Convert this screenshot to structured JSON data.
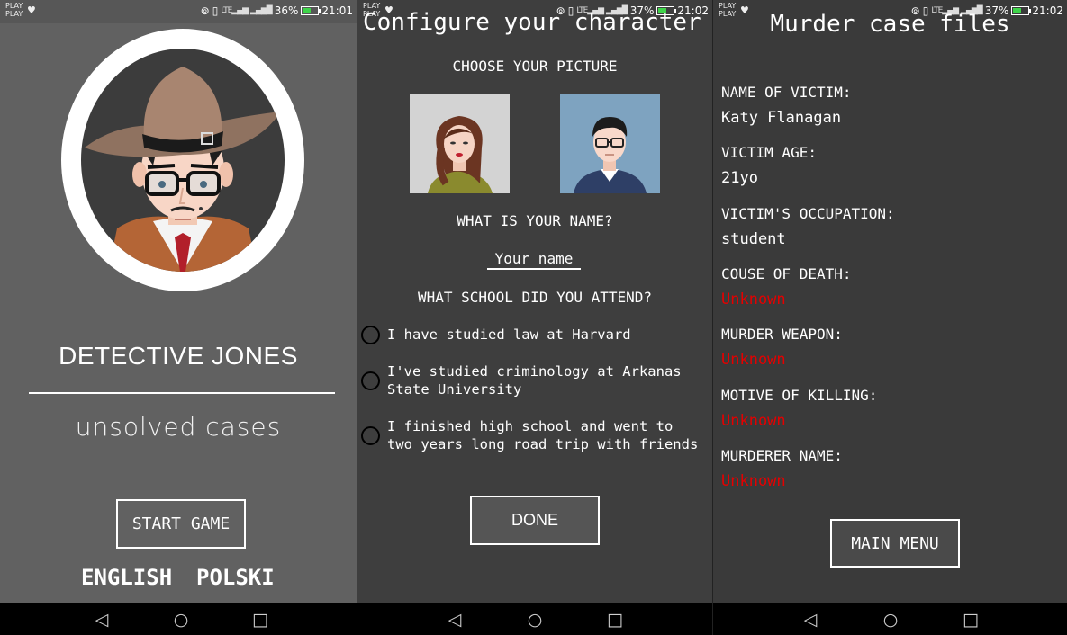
{
  "status_bars": [
    {
      "carrier": [
        "PLAY",
        "PLAY"
      ],
      "battery": "36%",
      "time": "21:01"
    },
    {
      "carrier": [
        "PLAY",
        "PLAY"
      ],
      "battery": "37%",
      "time": "21:02"
    },
    {
      "carrier": [
        "PLAY",
        "PLAY"
      ],
      "battery": "37%",
      "time": "21:02"
    }
  ],
  "home": {
    "title": "DETECTIVE JONES",
    "subtitle": "unsolved cases",
    "start_button": "START GAME",
    "languages": [
      "ENGLISH",
      "POLSKI"
    ]
  },
  "config": {
    "title": "Configure your character",
    "choose_picture_label": "CHOOSE YOUR PICTURE",
    "name_label": "WHAT IS YOUR NAME?",
    "name_placeholder": "Your name",
    "school_label": "WHAT SCHOOL DID YOU ATTEND?",
    "school_options": [
      "I have studied law at Harvard",
      "I've studied criminology at Arkanas State University",
      "I finished high school and went to two years long road trip with friends"
    ],
    "done_button": "DONE"
  },
  "case_files": {
    "title": "Murder case files",
    "fields": [
      {
        "label": "NAME OF VICTIM:",
        "value": "Katy Flanagan",
        "unknown": false
      },
      {
        "label": "VICTIM AGE:",
        "value": "21yo",
        "unknown": false
      },
      {
        "label": "VICTIM'S OCCUPATION:",
        "value": "student",
        "unknown": false
      },
      {
        "label": "COUSE OF DEATH:",
        "value": "Unknown",
        "unknown": true
      },
      {
        "label": "MURDER WEAPON:",
        "value": "Unknown",
        "unknown": true
      },
      {
        "label": "MOTIVE OF KILLING:",
        "value": "Unknown",
        "unknown": true
      },
      {
        "label": "MURDERER NAME:",
        "value": "Unknown",
        "unknown": true
      }
    ],
    "menu_button": "MAIN MENU"
  },
  "colors": {
    "screen1_bg": "#616161",
    "screen2_bg": "#3e3e3e",
    "screen3_bg": "#3a3a3a",
    "unknown_text": "#e40000",
    "navbar": "#000000"
  },
  "icons": {
    "nav": [
      "back-triangle-icon",
      "home-circle-icon",
      "recents-square-icon"
    ]
  }
}
